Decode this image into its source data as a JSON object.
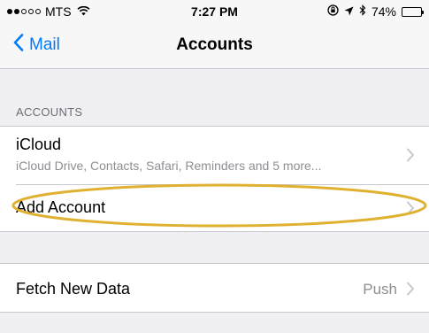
{
  "status_bar": {
    "carrier": "MTS",
    "time": "7:27 PM",
    "battery": "74%",
    "battery_level": 0.74,
    "signal_filled": 2,
    "signal_total": 5
  },
  "nav": {
    "back_label": "Mail",
    "title": "Accounts"
  },
  "accounts_section": {
    "header": "ACCOUNTS",
    "rows": [
      {
        "title": "iCloud",
        "subtitle": "iCloud Drive, Contacts, Safari, Reminders and 5 more..."
      },
      {
        "title": "Add Account"
      }
    ]
  },
  "fetch_section": {
    "title": "Fetch New Data",
    "value": "Push"
  },
  "colors": {
    "accent": "#007aff",
    "highlight": "#e0b030",
    "background": "#efeff4"
  }
}
